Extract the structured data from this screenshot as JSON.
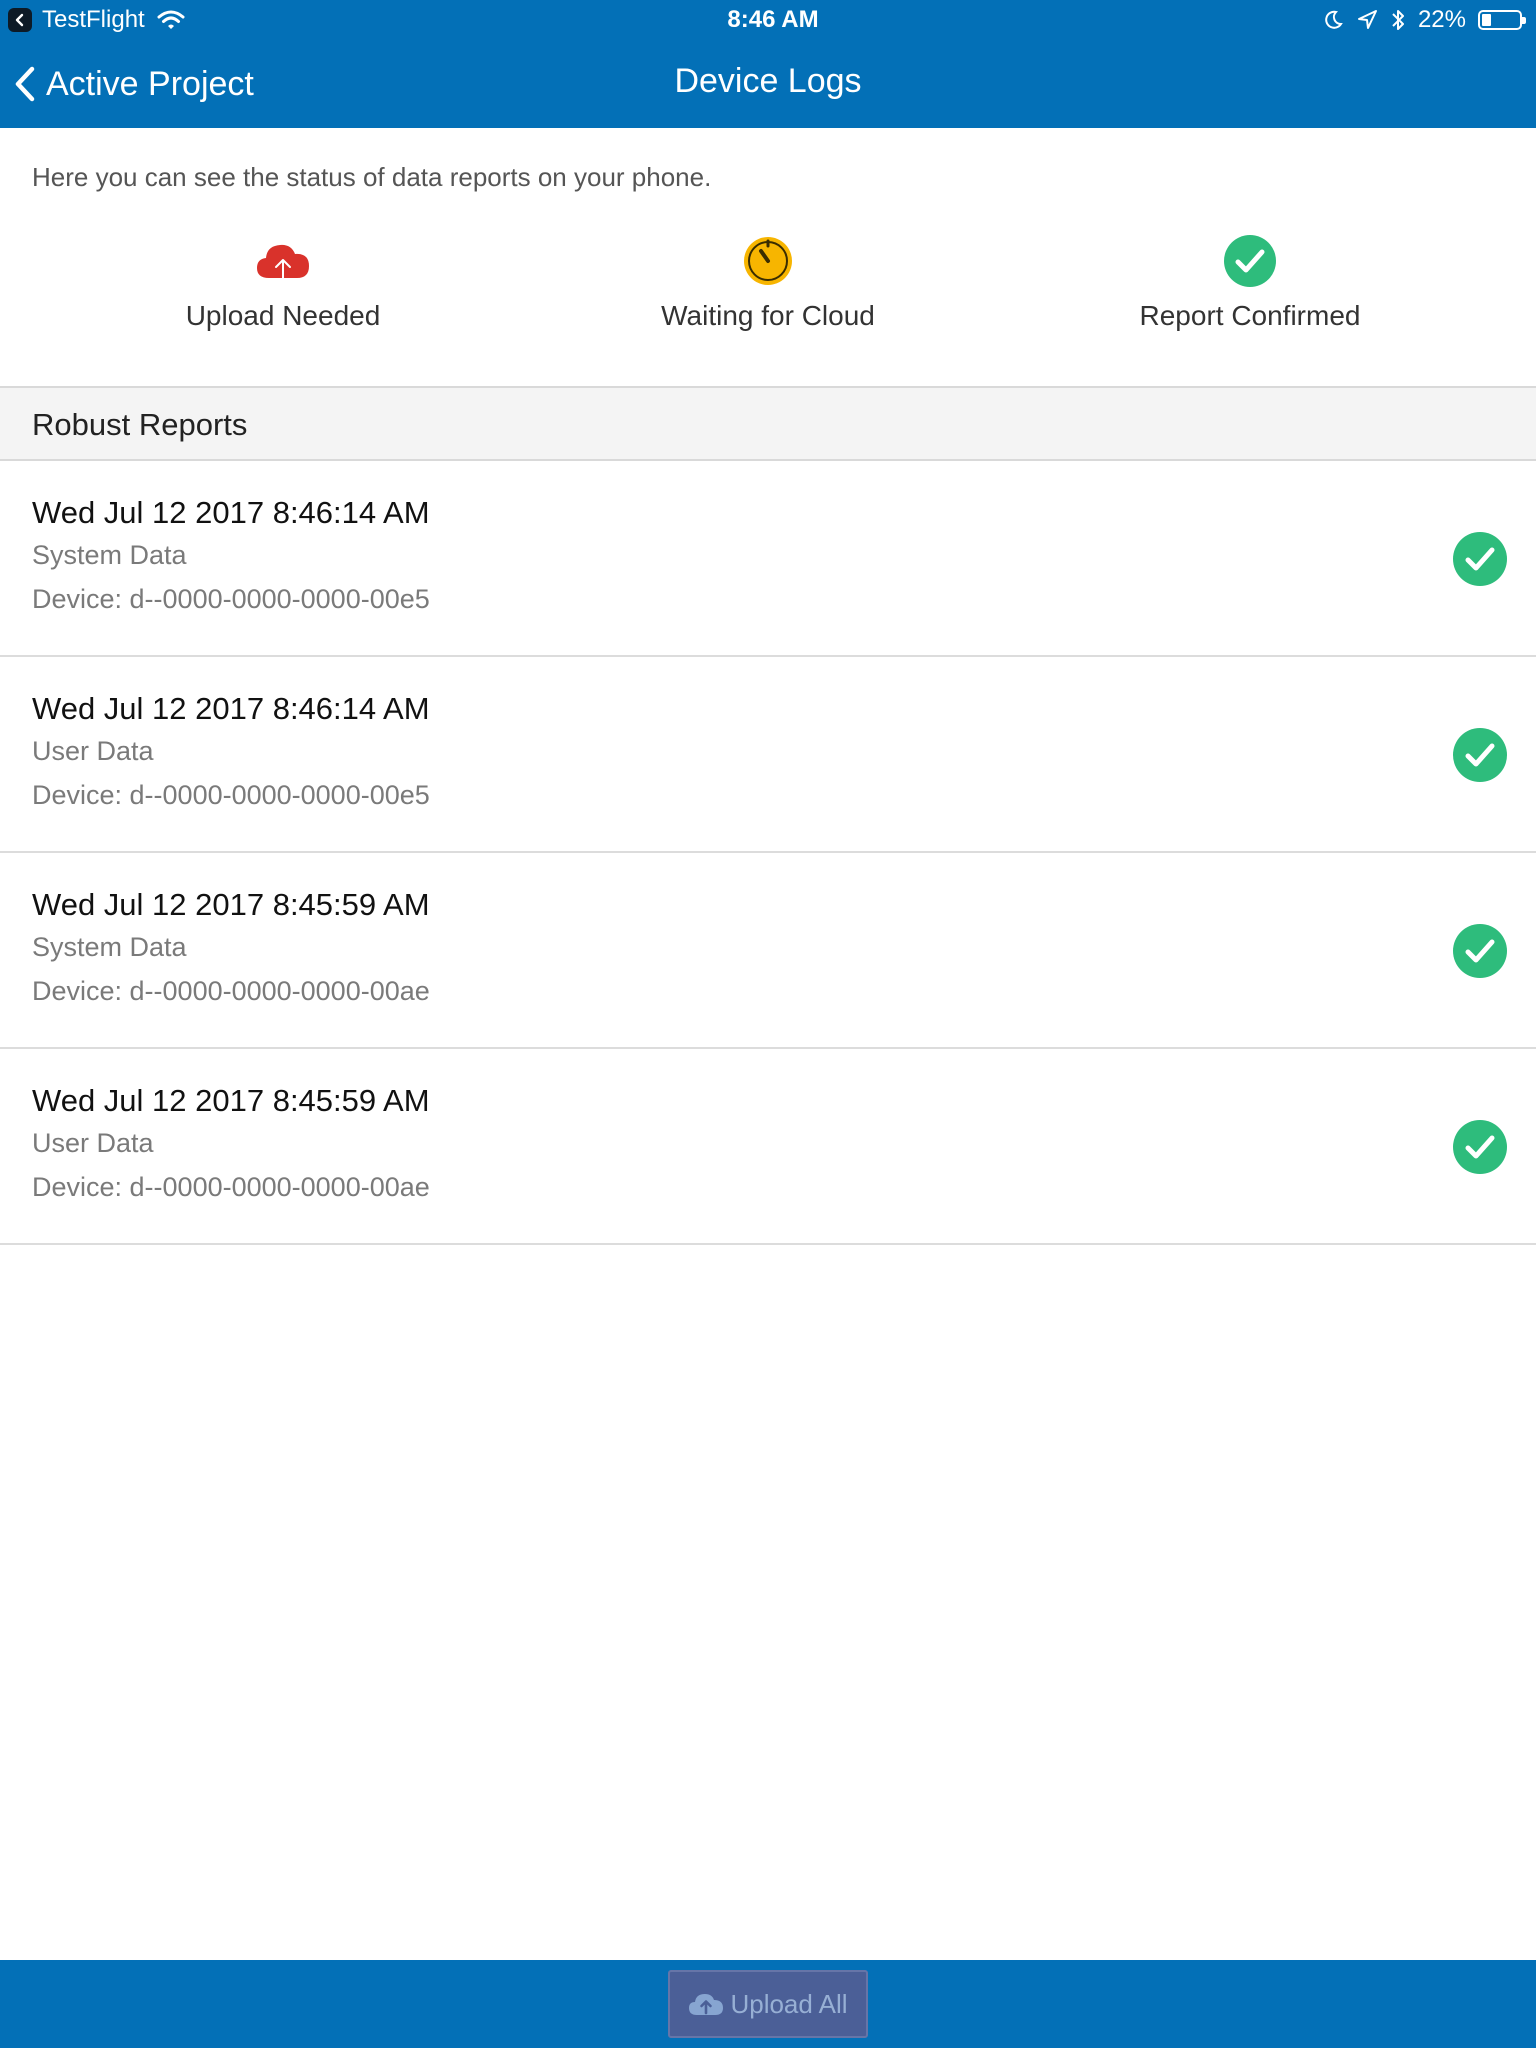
{
  "status_bar": {
    "app_name": "TestFlight",
    "time": "8:46 AM",
    "battery": "22%"
  },
  "nav": {
    "back_label": "Active Project",
    "title": "Device Logs"
  },
  "intro_text": "Here you can see the status of data reports on your phone.",
  "legend": [
    {
      "label": "Upload Needed",
      "icon": "cloud-upload-icon",
      "color": "#d9322b"
    },
    {
      "label": "Waiting for Cloud",
      "icon": "timer-icon",
      "color": "#f7b500"
    },
    {
      "label": "Report Confirmed",
      "icon": "check-circle-icon",
      "color": "#2ebc7c"
    }
  ],
  "section_title": "Robust Reports",
  "reports": [
    {
      "time": "Wed Jul 12 2017 8:46:14 AM",
      "type": "System Data",
      "device": "Device: d--0000-0000-0000-00e5",
      "status": "confirmed"
    },
    {
      "time": "Wed Jul 12 2017 8:46:14 AM",
      "type": "User Data",
      "device": "Device: d--0000-0000-0000-00e5",
      "status": "confirmed"
    },
    {
      "time": "Wed Jul 12 2017 8:45:59 AM",
      "type": "System Data",
      "device": "Device: d--0000-0000-0000-00ae",
      "status": "confirmed"
    },
    {
      "time": "Wed Jul 12 2017 8:45:59 AM",
      "type": "User Data",
      "device": "Device: d--0000-0000-0000-00ae",
      "status": "confirmed"
    }
  ],
  "bottom": {
    "upload_all_label": "Upload All"
  },
  "colors": {
    "brand_blue": "#0370b7",
    "confirmed_green": "#2ebc7c",
    "upload_button": "#4f5f96"
  }
}
